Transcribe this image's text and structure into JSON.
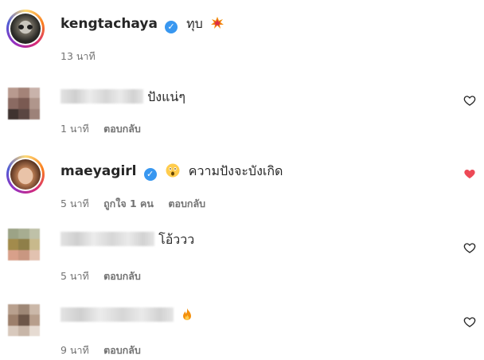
{
  "comments": [
    {
      "username": "kengtachaya",
      "text": "ทุบ",
      "time": "13 นาที",
      "emoji": "collision-emoji"
    },
    {
      "text": "ปังแน่ๆ",
      "time": "1 นาที",
      "reply": "ตอบกลับ"
    },
    {
      "username": "maeyagirl",
      "text": "ความปังจะบังเกิด",
      "time": "5 นาที",
      "likes": "ถูกใจ 1 คน",
      "reply": "ตอบกลับ",
      "emoji": "astonished-face-emoji"
    },
    {
      "text": "โอ้ววว",
      "time": "5 นาที",
      "reply": "ตอบกลับ"
    },
    {
      "text": "",
      "time": "9 นาที",
      "reply": "ตอบกลับ",
      "emoji": "fire-emoji"
    }
  ],
  "colors": {
    "liked_heart": "#ed4956",
    "verified": "#3897f0",
    "meta_text": "#737373"
  }
}
